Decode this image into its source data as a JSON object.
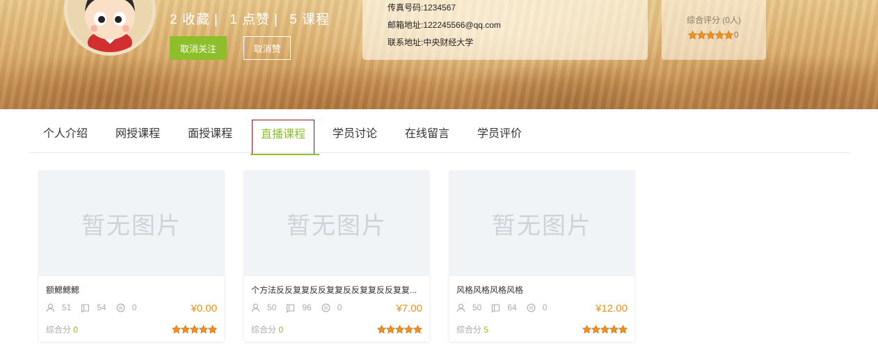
{
  "profile": {
    "stats": {
      "favorites": "2",
      "favorites_label": "收藏",
      "likes": "1",
      "likes_label": "点赞",
      "courses": "5",
      "courses_label": "课程",
      "separator": "|"
    },
    "buttons": {
      "unfollow": "取消关注",
      "unlike": "取消赞"
    }
  },
  "contact": {
    "fax": "传真号码:1234567",
    "email": "邮箱地址:122245566@qq.com",
    "address": "联系地址:中央财经大学"
  },
  "rating": {
    "label": "综合评分 (0人)",
    "count": "0",
    "stars": 5
  },
  "tabs": [
    {
      "label": "个人介绍",
      "active": false
    },
    {
      "label": "网授课程",
      "active": false
    },
    {
      "label": "面授课程",
      "active": false
    },
    {
      "label": "直播课程",
      "active": true
    },
    {
      "label": "学员讨论",
      "active": false
    },
    {
      "label": "在线留言",
      "active": false
    },
    {
      "label": "学员评价",
      "active": false
    }
  ],
  "courses": [
    {
      "placeholder": "暂无图片",
      "title": "额鰓鰓鰓",
      "students": "51",
      "lessons": "54",
      "comments": "0",
      "price": "¥0.00",
      "score_label": "综合分",
      "score": "0",
      "stars": 5
    },
    {
      "placeholder": "暂无图片",
      "title": "个方法反反复复反反复复反反复复反反复复...",
      "students": "50",
      "lessons": "96",
      "comments": "0",
      "price": "¥7.00",
      "score_label": "综合分",
      "score": "0",
      "stars": 5
    },
    {
      "placeholder": "暂无图片",
      "title": "风格风格风格风格",
      "students": "50",
      "lessons": "64",
      "comments": "0",
      "price": "¥12.00",
      "score_label": "综合分",
      "score": "5",
      "stars": 5
    }
  ],
  "colors": {
    "accent": "#8cbf2a",
    "price": "#f0901e",
    "star": "#f0901e",
    "active_outline": "#8b1a1a"
  },
  "icons": {
    "students": "user-icon",
    "lessons": "book-icon",
    "comments": "comment-icon",
    "star": "star-icon"
  }
}
